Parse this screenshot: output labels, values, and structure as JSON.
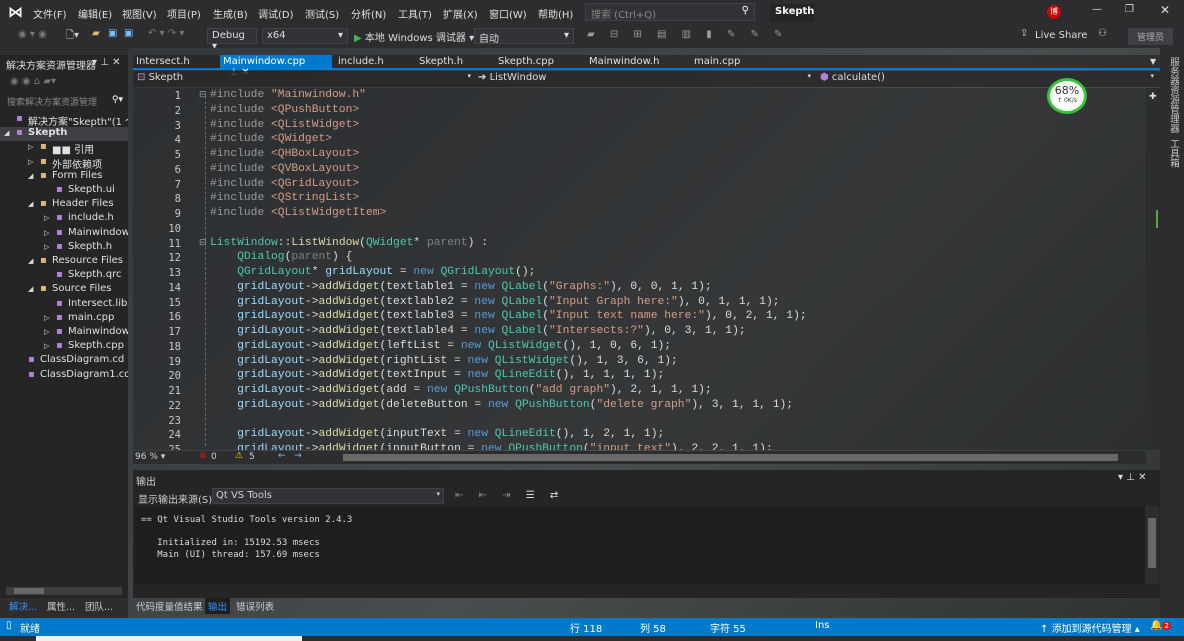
{
  "menu": {
    "items": [
      "文件(F)",
      "编辑(E)",
      "视图(V)",
      "项目(P)",
      "生成(B)",
      "调试(D)",
      "测试(S)",
      "分析(N)",
      "工具(T)",
      "扩展(X)",
      "窗口(W)",
      "帮助(H)"
    ],
    "search_placeholder": "搜索 (Ctrl+Q)",
    "app_title": "Skepth",
    "user_badge": "博"
  },
  "toolbar": {
    "config": "Debug",
    "platform": "x64",
    "run_label": "本地 Windows 调试器",
    "run_mode": "自动",
    "live_share": "Live Share",
    "admin": "管理员"
  },
  "solution_explorer": {
    "title": "解决方案资源管理器",
    "search_placeholder": "搜索解决方案资源管理",
    "tree": [
      {
        "label": "解决方案\"Skepth\"(1 个",
        "depth": 0,
        "arrow": ""
      },
      {
        "label": "Skepth",
        "depth": 0,
        "arrow": "◢",
        "bold": true
      },
      {
        "label": "■■ 引用",
        "depth": 2,
        "arrow": "▷"
      },
      {
        "label": "外部依赖项",
        "depth": 2,
        "arrow": "▷"
      },
      {
        "label": "Form Files",
        "depth": 2,
        "arrow": "◢"
      },
      {
        "label": "Skepth.ui",
        "depth": 3,
        "arrow": ""
      },
      {
        "label": "Header Files",
        "depth": 2,
        "arrow": "◢"
      },
      {
        "label": "include.h",
        "depth": 3,
        "arrow": "▷"
      },
      {
        "label": "Mainwindow.h",
        "depth": 3,
        "arrow": "▷"
      },
      {
        "label": "Skepth.h",
        "depth": 3,
        "arrow": "▷"
      },
      {
        "label": "Resource Files",
        "depth": 2,
        "arrow": "◢"
      },
      {
        "label": "Skepth.qrc",
        "depth": 3,
        "arrow": ""
      },
      {
        "label": "Source Files",
        "depth": 2,
        "arrow": "◢"
      },
      {
        "label": "Intersect.lib",
        "depth": 3,
        "arrow": ""
      },
      {
        "label": "main.cpp",
        "depth": 3,
        "arrow": "▷"
      },
      {
        "label": "Mainwindow.cpp",
        "depth": 3,
        "arrow": "▷"
      },
      {
        "label": "Skepth.cpp",
        "depth": 3,
        "arrow": "▷"
      },
      {
        "label": "ClassDiagram.cd",
        "depth": 1,
        "arrow": ""
      },
      {
        "label": "ClassDiagram1.cd",
        "depth": 1,
        "arrow": ""
      }
    ]
  },
  "tabs": [
    {
      "label": "Intersect.h"
    },
    {
      "label": "Mainwindow.cpp",
      "active": true
    },
    {
      "label": "include.h"
    },
    {
      "label": "Skepth.h"
    },
    {
      "label": "Skepth.cpp"
    },
    {
      "label": "Mainwindow.h"
    },
    {
      "label": "main.cpp"
    }
  ],
  "navbar": {
    "project": "Skepth",
    "scope": "ListWindow",
    "member": "calculate()"
  },
  "gauge": {
    "percent": "68%",
    "rate": "↑ 0K/s"
  },
  "code": [
    {
      "n": "1",
      "t": [
        [
          "#include ",
          "pp"
        ],
        [
          "\"Mainwindow.h\"",
          "str"
        ]
      ]
    },
    {
      "n": "2",
      "t": [
        [
          "#include ",
          "pp"
        ],
        [
          "<QPushButton>",
          "str"
        ]
      ]
    },
    {
      "n": "3",
      "t": [
        [
          "#include ",
          "pp"
        ],
        [
          "<QListWidget>",
          "str"
        ]
      ]
    },
    {
      "n": "4",
      "t": [
        [
          "#include ",
          "pp"
        ],
        [
          "<QWidget>",
          "str"
        ]
      ]
    },
    {
      "n": "5",
      "t": [
        [
          "#include ",
          "pp"
        ],
        [
          "<QHBoxLayout>",
          "str"
        ]
      ]
    },
    {
      "n": "6",
      "t": [
        [
          "#include ",
          "pp"
        ],
        [
          "<QVBoxLayout>",
          "str"
        ]
      ]
    },
    {
      "n": "7",
      "t": [
        [
          "#include ",
          "pp"
        ],
        [
          "<QGridLayout>",
          "str"
        ]
      ]
    },
    {
      "n": "8",
      "t": [
        [
          "#include ",
          "pp"
        ],
        [
          "<QStringList>",
          "str"
        ]
      ]
    },
    {
      "n": "9",
      "t": [
        [
          "#include ",
          "pp"
        ],
        [
          "<QListWidgetItem>",
          "str"
        ]
      ]
    },
    {
      "n": "10",
      "t": []
    },
    {
      "n": "11",
      "t": [
        [
          "ListWindow",
          "type"
        ],
        [
          "::",
          "pl"
        ],
        [
          "ListWindow",
          "fn"
        ],
        [
          "(",
          "pl"
        ],
        [
          "QWidget",
          "type"
        ],
        [
          "* ",
          "pl"
        ],
        [
          "parent",
          "par"
        ],
        [
          ") :",
          "pl"
        ]
      ]
    },
    {
      "n": "12",
      "t": [
        [
          "    QDialog",
          "type"
        ],
        [
          "(",
          "pl"
        ],
        [
          "parent",
          "par"
        ],
        [
          ") {",
          "pl"
        ]
      ]
    },
    {
      "n": "13",
      "t": [
        [
          "    QGridLayout",
          "type"
        ],
        [
          "* ",
          "pl"
        ],
        [
          "gridLayout",
          "var"
        ],
        [
          " = ",
          "pl"
        ],
        [
          "new ",
          "kw"
        ],
        [
          "QGridLayout",
          "type"
        ],
        [
          "();",
          "pl"
        ]
      ]
    },
    {
      "n": "14",
      "t": [
        [
          "    gridLayout",
          "var"
        ],
        [
          "->",
          "pl"
        ],
        [
          "addWidget",
          "fn"
        ],
        [
          "(textlable1 = ",
          "pl"
        ],
        [
          "new ",
          "kw"
        ],
        [
          "QLabel",
          "type"
        ],
        [
          "(",
          "pl"
        ],
        [
          "\"Graphs:\"",
          "str"
        ],
        [
          "), 0, 0, 1, 1);",
          "pl"
        ]
      ]
    },
    {
      "n": "15",
      "t": [
        [
          "    gridLayout",
          "var"
        ],
        [
          "->",
          "pl"
        ],
        [
          "addWidget",
          "fn"
        ],
        [
          "(textlable2 = ",
          "pl"
        ],
        [
          "new ",
          "kw"
        ],
        [
          "QLabel",
          "type"
        ],
        [
          "(",
          "pl"
        ],
        [
          "\"Input Graph here:\"",
          "str"
        ],
        [
          "), 0, 1, 1, 1);",
          "pl"
        ]
      ]
    },
    {
      "n": "16",
      "t": [
        [
          "    gridLayout",
          "var"
        ],
        [
          "->",
          "pl"
        ],
        [
          "addWidget",
          "fn"
        ],
        [
          "(textlable3 = ",
          "pl"
        ],
        [
          "new ",
          "kw"
        ],
        [
          "QLabel",
          "type"
        ],
        [
          "(",
          "pl"
        ],
        [
          "\"Input text name here:\"",
          "str"
        ],
        [
          "), 0, 2, 1, 1);",
          "pl"
        ]
      ]
    },
    {
      "n": "17",
      "t": [
        [
          "    gridLayout",
          "var"
        ],
        [
          "->",
          "pl"
        ],
        [
          "addWidget",
          "fn"
        ],
        [
          "(textlable4 = ",
          "pl"
        ],
        [
          "new ",
          "kw"
        ],
        [
          "QLabel",
          "type"
        ],
        [
          "(",
          "pl"
        ],
        [
          "\"Intersects:?\"",
          "str"
        ],
        [
          "), 0, 3, 1, 1);",
          "pl"
        ]
      ]
    },
    {
      "n": "18",
      "t": [
        [
          "    gridLayout",
          "var"
        ],
        [
          "->",
          "pl"
        ],
        [
          "addWidget",
          "fn"
        ],
        [
          "(leftList = ",
          "pl"
        ],
        [
          "new ",
          "kw"
        ],
        [
          "QListWidget",
          "type"
        ],
        [
          "(), 1, 0, 6, 1);",
          "pl"
        ]
      ]
    },
    {
      "n": "19",
      "t": [
        [
          "    gridLayout",
          "var"
        ],
        [
          "->",
          "pl"
        ],
        [
          "addWidget",
          "fn"
        ],
        [
          "(rightList = ",
          "pl"
        ],
        [
          "new ",
          "kw"
        ],
        [
          "QListWidget",
          "type"
        ],
        [
          "(), 1, 3, 6, 1);",
          "pl"
        ]
      ]
    },
    {
      "n": "20",
      "t": [
        [
          "    gridLayout",
          "var"
        ],
        [
          "->",
          "pl"
        ],
        [
          "addWidget",
          "fn"
        ],
        [
          "(textInput = ",
          "pl"
        ],
        [
          "new ",
          "kw"
        ],
        [
          "QLineEdit",
          "type"
        ],
        [
          "(), 1, 1, 1, 1);",
          "pl"
        ]
      ]
    },
    {
      "n": "21",
      "t": [
        [
          "    gridLayout",
          "var"
        ],
        [
          "->",
          "pl"
        ],
        [
          "addWidget",
          "fn"
        ],
        [
          "(add = ",
          "pl"
        ],
        [
          "new ",
          "kw"
        ],
        [
          "QPushButton",
          "type"
        ],
        [
          "(",
          "pl"
        ],
        [
          "\"add graph\"",
          "str"
        ],
        [
          "), 2, 1, 1, 1);",
          "pl"
        ]
      ]
    },
    {
      "n": "22",
      "t": [
        [
          "    gridLayout",
          "var"
        ],
        [
          "->",
          "pl"
        ],
        [
          "addWidget",
          "fn"
        ],
        [
          "(deleteButton = ",
          "pl"
        ],
        [
          "new ",
          "kw"
        ],
        [
          "QPushButton",
          "type"
        ],
        [
          "(",
          "pl"
        ],
        [
          "\"delete graph\"",
          "str"
        ],
        [
          "), 3, 1, 1, 1);",
          "pl"
        ]
      ]
    },
    {
      "n": "23",
      "t": []
    },
    {
      "n": "24",
      "t": [
        [
          "    gridLayout",
          "var"
        ],
        [
          "->",
          "pl"
        ],
        [
          "addWidget",
          "fn"
        ],
        [
          "(inputText = ",
          "pl"
        ],
        [
          "new ",
          "kw"
        ],
        [
          "QLineEdit",
          "type"
        ],
        [
          "(), 1, 2, 1, 1);",
          "pl"
        ]
      ]
    },
    {
      "n": "25",
      "t": [
        [
          "    gridLayout",
          "var"
        ],
        [
          "->",
          "pl"
        ],
        [
          "addWidget",
          "fn"
        ],
        [
          "(inputButton = ",
          "pl"
        ],
        [
          "new ",
          "kw"
        ],
        [
          "QPushButton",
          "type"
        ],
        [
          "(",
          "pl"
        ],
        [
          "\"input text\"",
          "str"
        ],
        [
          "), 2, 2, 1, 1);",
          "pl"
        ]
      ]
    }
  ],
  "editor_status": {
    "zoom": "96 %",
    "errors": "0",
    "warnings": "5"
  },
  "output": {
    "title": "输出",
    "source_label": "显示输出来源(S):",
    "source": "Qt VS Tools",
    "lines": "== Qt Visual Studio Tools version 2.4.3\n\n   Initialized in: 15192.53 msecs\n   Main (UI) thread: 157.69 msecs"
  },
  "bottom_tabs": {
    "left": [
      "解决...",
      "属性...",
      "团队..."
    ],
    "main": [
      "代码度量值结果",
      "输出",
      "错误列表"
    ]
  },
  "right_strip": [
    "服务器资源管理器",
    "工具箱"
  ],
  "status": {
    "ready": "就绪",
    "line": "行 118",
    "col": "列 58",
    "char": "字符 55",
    "ins": "Ins",
    "source_control": "添加到源代码管理",
    "notifications": "2"
  }
}
